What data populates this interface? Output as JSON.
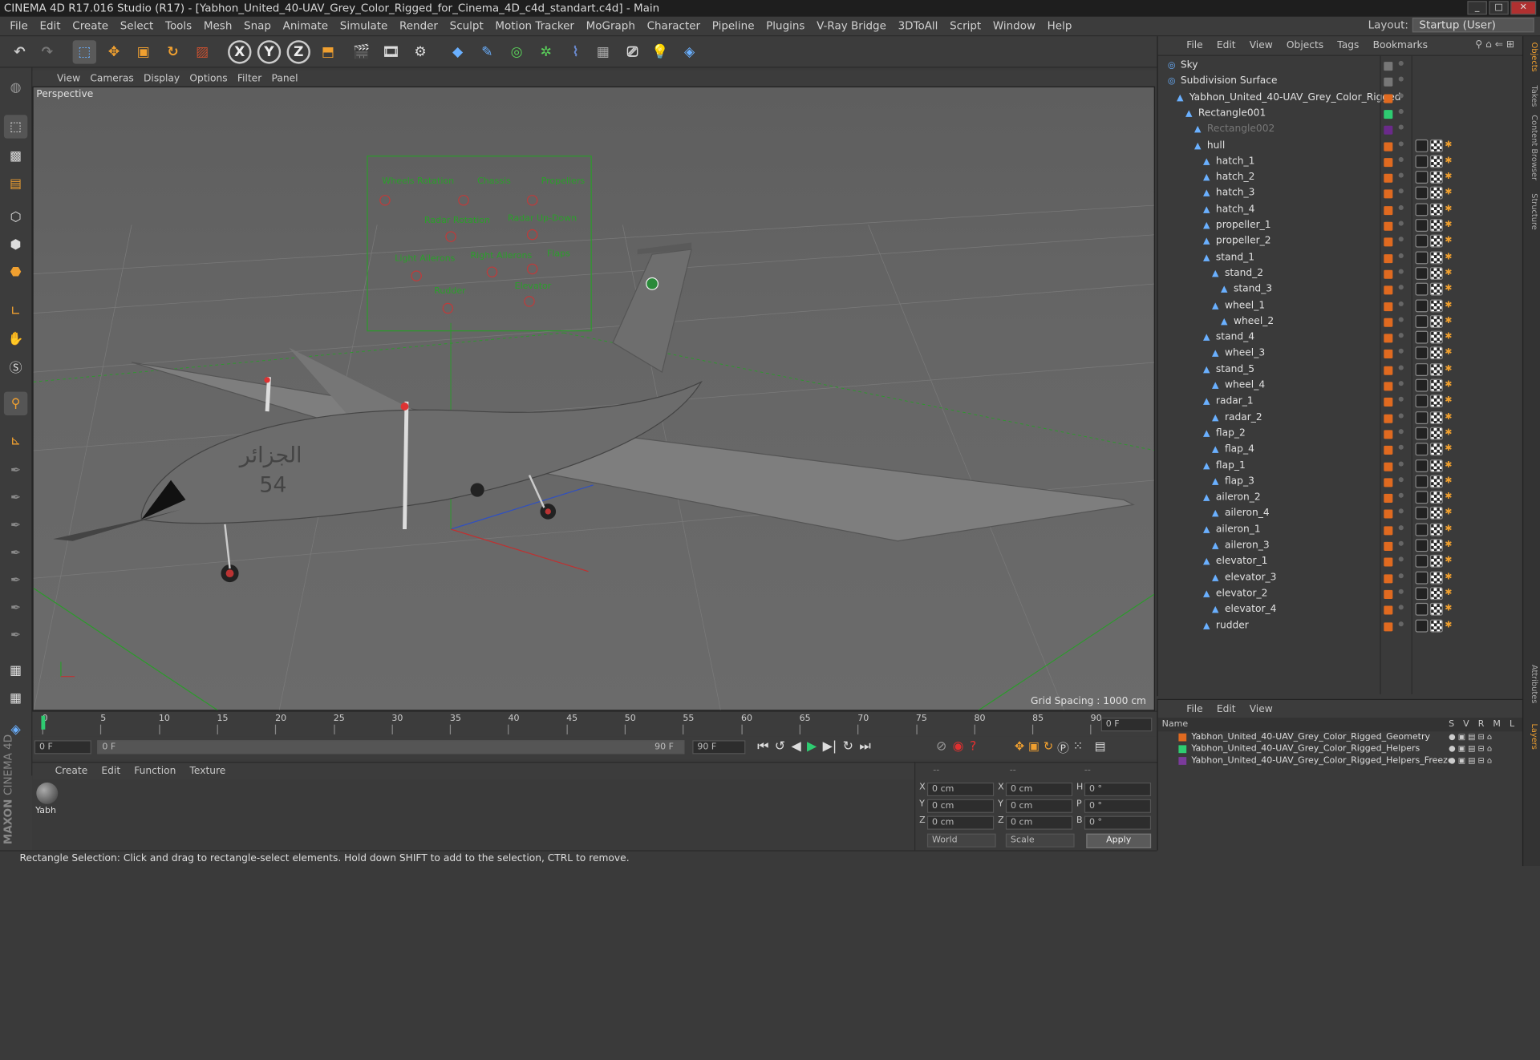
{
  "title": "CINEMA 4D R17.016 Studio (R17) - [Yabhon_United_40-UAV_Grey_Color_Rigged_for_Cinema_4D_c4d_standart.c4d] - Main",
  "menubar": [
    "File",
    "Edit",
    "Create",
    "Select",
    "Tools",
    "Mesh",
    "Snap",
    "Animate",
    "Simulate",
    "Render",
    "Sculpt",
    "Motion Tracker",
    "MoGraph",
    "Character",
    "Pipeline",
    "Plugins",
    "V-Ray Bridge",
    "3DToAll",
    "Script",
    "Window",
    "Help"
  ],
  "layout": {
    "label": "Layout:",
    "value": "Startup (User)"
  },
  "viewport": {
    "menu": [
      "View",
      "Cameras",
      "Display",
      "Options",
      "Filter",
      "Panel"
    ],
    "label": "Perspective",
    "grid_spacing": "Grid Spacing : 1000 cm",
    "controls": [
      "Wheels Rotation",
      "Chassis",
      "Propellers",
      "Radar Rotation",
      "Radar Up-Down",
      "Light Ailerons",
      "Right Ailerons",
      "Flaps",
      "Rudder",
      "Elevator"
    ]
  },
  "timeline": {
    "ticks": [
      "0",
      "5",
      "10",
      "15",
      "20",
      "25",
      "30",
      "35",
      "40",
      "45",
      "50",
      "55",
      "60",
      "65",
      "70",
      "75",
      "80",
      "85",
      "90"
    ],
    "current": "0 F",
    "start": "0 F",
    "end": "90 F",
    "range_start": "0 F",
    "range_end": "90 F",
    "range_end2": "90 F"
  },
  "material": {
    "menu": [
      "Create",
      "Edit",
      "Function",
      "Texture"
    ],
    "items": [
      "Yabh"
    ]
  },
  "coords": {
    "x": "0 cm",
    "y": "0 cm",
    "z": "0 cm",
    "x2": "0 cm",
    "y2": "0 cm",
    "z2": "0 cm",
    "h": "0 °",
    "p": "0 °",
    "b": "0 °",
    "mode1": "World",
    "mode2": "Scale",
    "apply": "Apply",
    "dash1": "--",
    "dash2": "--",
    "dash3": "--"
  },
  "status": "Rectangle Selection: Click and drag to rectangle-select elements. Hold down SHIFT to add to the selection, CTRL to remove.",
  "objmgr": {
    "menu": [
      "File",
      "Edit",
      "View",
      "Objects",
      "Tags",
      "Bookmarks"
    ],
    "objects": [
      {
        "name": "Sky",
        "depth": 0,
        "tag": "#777"
      },
      {
        "name": "Subdivision Surface",
        "depth": 0,
        "tag": "#777"
      },
      {
        "name": "Yabhon_United_40-UAV_Grey_Color_Rigged",
        "depth": 1,
        "tag": "#e06a20"
      },
      {
        "name": "Rectangle001",
        "depth": 2,
        "tag": "#2ecc71"
      },
      {
        "name": "Rectangle002",
        "depth": 3,
        "tag": "#6a2a8a"
      },
      {
        "name": "hull",
        "depth": 3,
        "tag": "#e06a20"
      },
      {
        "name": "hatch_1",
        "depth": 4,
        "tag": "#e06a20"
      },
      {
        "name": "hatch_2",
        "depth": 4,
        "tag": "#e06a20"
      },
      {
        "name": "hatch_3",
        "depth": 4,
        "tag": "#e06a20"
      },
      {
        "name": "hatch_4",
        "depth": 4,
        "tag": "#e06a20"
      },
      {
        "name": "propeller_1",
        "depth": 4,
        "tag": "#e06a20"
      },
      {
        "name": "propeller_2",
        "depth": 4,
        "tag": "#e06a20"
      },
      {
        "name": "stand_1",
        "depth": 4,
        "tag": "#e06a20"
      },
      {
        "name": "stand_2",
        "depth": 5,
        "tag": "#e06a20"
      },
      {
        "name": "stand_3",
        "depth": 6,
        "tag": "#e06a20"
      },
      {
        "name": "wheel_1",
        "depth": 5,
        "tag": "#e06a20"
      },
      {
        "name": "wheel_2",
        "depth": 6,
        "tag": "#e06a20"
      },
      {
        "name": "stand_4",
        "depth": 4,
        "tag": "#e06a20"
      },
      {
        "name": "wheel_3",
        "depth": 5,
        "tag": "#e06a20"
      },
      {
        "name": "stand_5",
        "depth": 4,
        "tag": "#e06a20"
      },
      {
        "name": "wheel_4",
        "depth": 5,
        "tag": "#e06a20"
      },
      {
        "name": "radar_1",
        "depth": 4,
        "tag": "#e06a20"
      },
      {
        "name": "radar_2",
        "depth": 5,
        "tag": "#e06a20"
      },
      {
        "name": "flap_2",
        "depth": 4,
        "tag": "#e06a20"
      },
      {
        "name": "flap_4",
        "depth": 5,
        "tag": "#e06a20"
      },
      {
        "name": "flap_1",
        "depth": 4,
        "tag": "#e06a20"
      },
      {
        "name": "flap_3",
        "depth": 5,
        "tag": "#e06a20"
      },
      {
        "name": "aileron_2",
        "depth": 4,
        "tag": "#e06a20"
      },
      {
        "name": "aileron_4",
        "depth": 5,
        "tag": "#e06a20"
      },
      {
        "name": "aileron_1",
        "depth": 4,
        "tag": "#e06a20"
      },
      {
        "name": "aileron_3",
        "depth": 5,
        "tag": "#e06a20"
      },
      {
        "name": "elevator_1",
        "depth": 4,
        "tag": "#e06a20"
      },
      {
        "name": "elevator_3",
        "depth": 5,
        "tag": "#e06a20"
      },
      {
        "name": "elevator_2",
        "depth": 4,
        "tag": "#e06a20"
      },
      {
        "name": "elevator_4",
        "depth": 5,
        "tag": "#e06a20"
      },
      {
        "name": "rudder",
        "depth": 4,
        "tag": "#e06a20"
      }
    ]
  },
  "layers": {
    "menu": [
      "File",
      "Edit",
      "View"
    ],
    "header": {
      "name": "Name",
      "cols": [
        "S",
        "V",
        "R",
        "M",
        "L"
      ]
    },
    "items": [
      {
        "name": "Yabhon_United_40-UAV_Grey_Color_Rigged_Geometry",
        "color": "#e06a20"
      },
      {
        "name": "Yabhon_United_40-UAV_Grey_Color_Rigged_Helpers",
        "color": "#2ecc71"
      },
      {
        "name": "Yabhon_United_40-UAV_Grey_Color_Rigged_Helpers_Freeze",
        "color": "#7a3a9a"
      }
    ]
  },
  "right_tabs": [
    "Objects",
    "Takes",
    "Content Browser",
    "Structure",
    "Attributes",
    "Layers"
  ],
  "logo": {
    "maxon": "MAXON",
    "c4d": "CINEMA 4D"
  }
}
